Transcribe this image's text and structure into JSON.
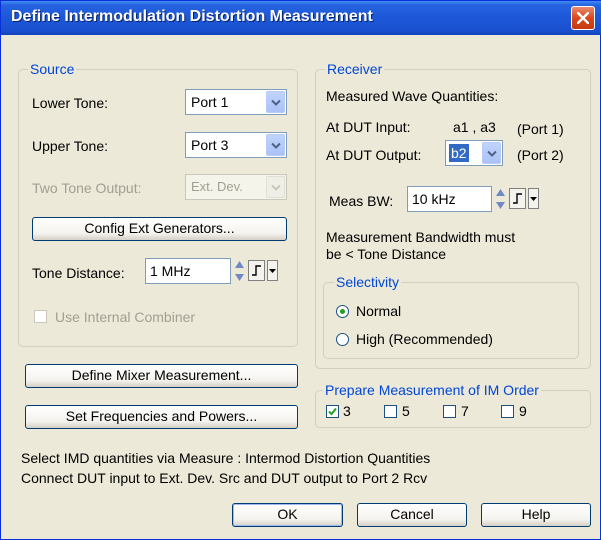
{
  "window": {
    "title": "Define Intermodulation Distortion Measurement"
  },
  "source": {
    "legend": "Source",
    "lower_tone_label": "Lower Tone:",
    "lower_tone_value": "Port 1",
    "upper_tone_label": "Upper Tone:",
    "upper_tone_value": "Port 3",
    "two_tone_label": "Two Tone Output:",
    "two_tone_value": "Ext. Dev.",
    "config_button": "Config Ext Generators...",
    "tone_distance_label": "Tone Distance:",
    "tone_distance_value": "1 MHz",
    "combiner_label": "Use Internal Combiner"
  },
  "receiver": {
    "legend": "Receiver",
    "measured_label": "Measured Wave Quantities:",
    "dut_input_label": "At DUT Input:",
    "dut_input_value": "a1 , a3",
    "dut_input_port": "(Port 1)",
    "dut_output_label": "At DUT Output:",
    "dut_output_value": "b2",
    "dut_output_port": "(Port 2)",
    "meas_bw_label": "Meas BW:",
    "meas_bw_value": "10 kHz",
    "bw_note_line1": "Measurement Bandwidth must",
    "bw_note_line2": "be < Tone Distance"
  },
  "selectivity": {
    "legend": "Selectivity",
    "options": [
      "Normal",
      "High (Recommended)"
    ],
    "selected": "Normal"
  },
  "buttons": {
    "define_mixer": "Define Mixer Measurement...",
    "set_freq": "Set Frequencies and Powers...",
    "ok": "OK",
    "cancel": "Cancel",
    "help": "Help"
  },
  "im_order": {
    "legend": "Prepare Measurement of IM Order",
    "orders": [
      {
        "label": "3",
        "checked": true
      },
      {
        "label": "5",
        "checked": false
      },
      {
        "label": "7",
        "checked": false
      },
      {
        "label": "9",
        "checked": false
      }
    ]
  },
  "info": {
    "line1": "Select IMD quantities via Measure : Intermod Distortion Quantities",
    "line2": "Connect DUT input to Ext. Dev. Src and DUT output to Port 2 Rcv"
  },
  "colors": {
    "titlebar": "#1C57D8",
    "dialog_bg": "#ECE9D8",
    "group_label": "#0046D5"
  }
}
